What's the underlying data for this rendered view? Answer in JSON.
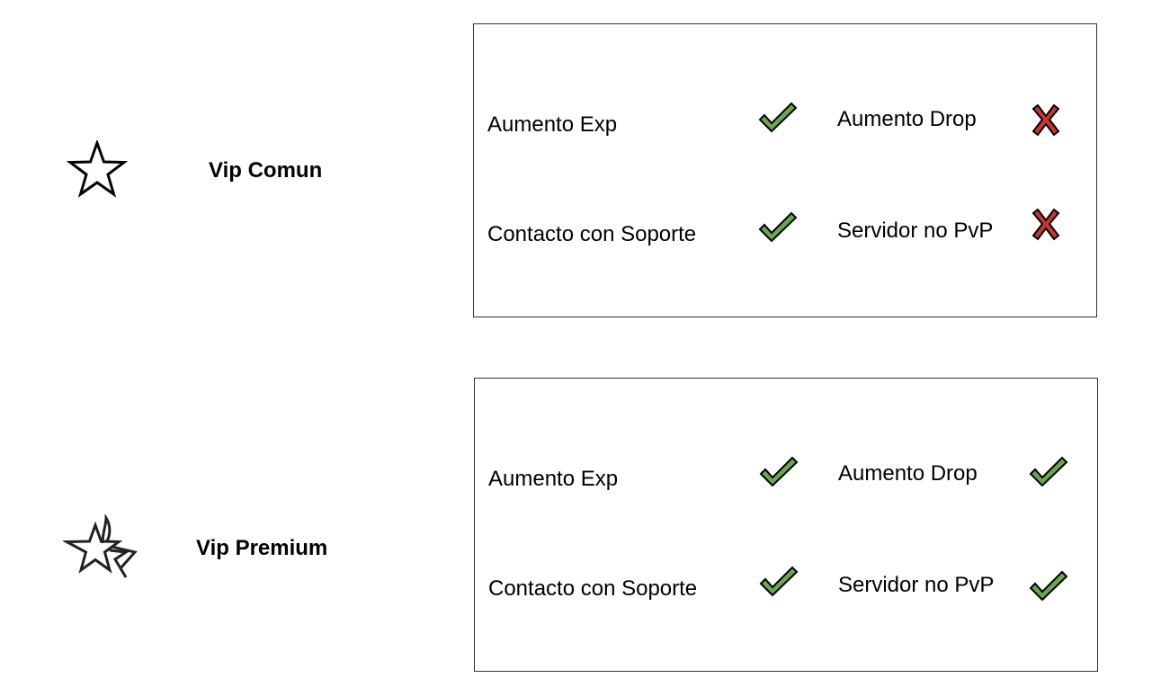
{
  "tiers": [
    {
      "name": "Vip Comun",
      "icon": "star-outline-icon",
      "features": [
        {
          "label": "Aumento Exp",
          "included": true
        },
        {
          "label": "Aumento Drop",
          "included": false
        },
        {
          "label": "Contacto con Soporte",
          "included": true
        },
        {
          "label": "Servidor no PvP",
          "included": false
        }
      ]
    },
    {
      "name": "Vip Premium",
      "icon": "star-with-trails-icon",
      "features": [
        {
          "label": "Aumento Exp",
          "included": true
        },
        {
          "label": "Aumento Drop",
          "included": true
        },
        {
          "label": "Contacto con Soporte",
          "included": true
        },
        {
          "label": "Servidor no PvP",
          "included": true
        }
      ]
    }
  ],
  "colors": {
    "check_fill": "#6aa84f",
    "cross_fill": "#cc3333",
    "outline": "#000000",
    "box_border": "#333333"
  }
}
